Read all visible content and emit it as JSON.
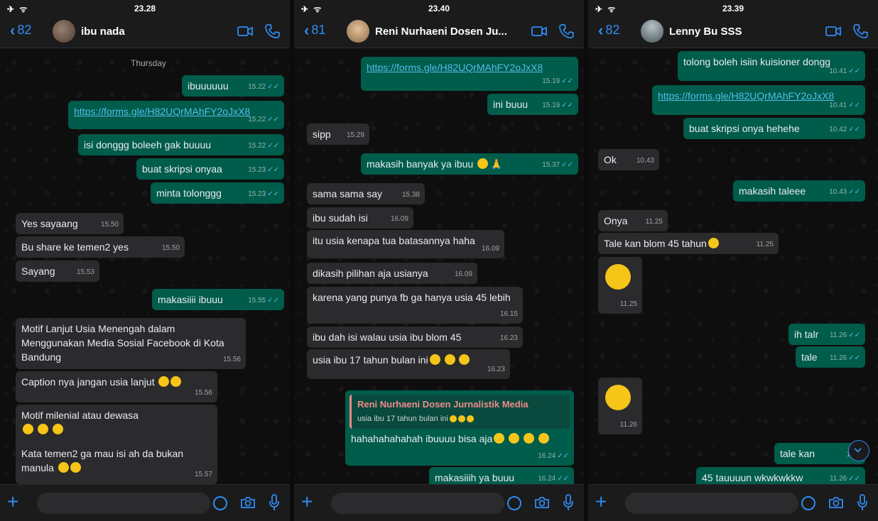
{
  "panels": [
    {
      "status_time": "23.28",
      "back_count": "82",
      "contact_name": "ibu nada",
      "avatar_color": "#6b5b4b",
      "day_label": "Thursday",
      "messages": [
        {
          "dir": "out",
          "text": "ibuuuuuu",
          "time": "15.22"
        },
        {
          "dir": "out",
          "text": "https://forms.gle/H82UQrMAhFY2oJxX8",
          "time": "15.22",
          "link": true
        },
        {
          "dir": "out",
          "text": "isi donggg boleeh gak buuuu",
          "time": "15.22"
        },
        {
          "dir": "out",
          "text": "buat skripsi onyaa",
          "time": "15.23"
        },
        {
          "dir": "out",
          "text": "minta tolonggg",
          "time": "15.23"
        },
        {
          "dir": "in",
          "text": "Yes sayaang",
          "time": "15.50"
        },
        {
          "dir": "in",
          "text": "Bu share ke temen2 yes",
          "time": "15.50"
        },
        {
          "dir": "in",
          "text": "Sayang",
          "time": "15.53"
        },
        {
          "dir": "out",
          "text": "makasiiii ibuuu",
          "time": "15.55"
        },
        {
          "dir": "in",
          "text": "Motif Lanjut Usia Menengah dalam Menggunakan Media Sosial Facebook di Kota Bandung",
          "time": "15.56"
        },
        {
          "dir": "in",
          "text": "Caption nya jangan usia lanjut",
          "time": "15.56"
        },
        {
          "dir": "in",
          "text": "Motif milenial atau dewasa",
          "time": ""
        },
        {
          "dir": "in",
          "text": "Kata temen2 ga mau isi ah da bukan manula",
          "time": "15.57"
        }
      ]
    },
    {
      "status_time": "23.40",
      "back_count": "81",
      "contact_name": "Reni Nurhaeni Dosen Ju...",
      "avatar_color": "#c9a27a",
      "messages": [
        {
          "dir": "out",
          "text": "https://forms.gle/H82UQrMAhFY2oJxX8",
          "time": "15.19",
          "link": true
        },
        {
          "dir": "out",
          "text": "ini buuu",
          "time": "15.19"
        },
        {
          "dir": "in",
          "text": "sipp",
          "time": "15.29"
        },
        {
          "dir": "out",
          "text": "makasih banyak ya ibuu",
          "time": "15.37"
        },
        {
          "dir": "in",
          "text": "sama sama say",
          "time": "15.38"
        },
        {
          "dir": "in",
          "text": "ibu sudah isi",
          "time": "16.09"
        },
        {
          "dir": "in",
          "text": "itu usia kenapa tua batasannya haha",
          "time": "16.09"
        },
        {
          "dir": "in",
          "text": "dikasih pilihan aja usianya",
          "time": "16.09"
        },
        {
          "dir": "in",
          "text": "karena yang punya fb ga hanya usia 45 lebih",
          "time": "16.15"
        },
        {
          "dir": "in",
          "text": "ibu dah isi walau usia ibu blom 45",
          "time": "16.23"
        },
        {
          "dir": "in",
          "text": "usia ibu 17 tahun bulan ini",
          "time": "16.23"
        },
        {
          "dir": "out",
          "text": "hahahahahahah ibuuuu bisa aja",
          "time": "16.24",
          "quote_name": "Reni Nurhaeni Dosen Jurnalistik Media",
          "quote_text": "usia ibu 17 tahun bulan ini"
        },
        {
          "dir": "out",
          "text": "makasiiih ya buuu",
          "time": "16.24"
        }
      ]
    },
    {
      "status_time": "23.39",
      "back_count": "82",
      "contact_name": "Lenny Bu SSS",
      "avatar_color": "#7f8b93",
      "messages": [
        {
          "dir": "out",
          "text": "tolong boleh isiin kuisioner dongg",
          "time": "10.41"
        },
        {
          "dir": "out",
          "text": "https://forms.gle/H82UQrMAhFY2oJxX8",
          "time": "10.41",
          "link": true
        },
        {
          "dir": "out",
          "text": "buat skripsi onya hehehe",
          "time": "10.42"
        },
        {
          "dir": "in",
          "text": "Ok",
          "time": "10.43"
        },
        {
          "dir": "out",
          "text": "makasih taleee",
          "time": "10.43"
        },
        {
          "dir": "in",
          "text": "Onya",
          "time": "11.25"
        },
        {
          "dir": "in",
          "text": "Tale kan blom 45 tahun",
          "time": "11.25"
        },
        {
          "dir": "in",
          "text": "",
          "time": "11.25",
          "emoji_only": "laughing-tears"
        },
        {
          "dir": "out",
          "text": "ih talr",
          "time": "11.26"
        },
        {
          "dir": "out",
          "text": "tale",
          "time": "11.26"
        },
        {
          "dir": "in",
          "text": "",
          "time": "11.26",
          "emoji_only": "tongue-squint"
        },
        {
          "dir": "out",
          "text": "tale kan",
          "time": "11"
        },
        {
          "dir": "out",
          "text": "45 tauuuun wkwkwkkw",
          "time": "11.26"
        }
      ]
    }
  ],
  "colors": {
    "accent": "#2f8cf2",
    "outgoing": "#005c4b",
    "incoming": "#2b2b2d",
    "read_tick": "#53bdeb"
  }
}
